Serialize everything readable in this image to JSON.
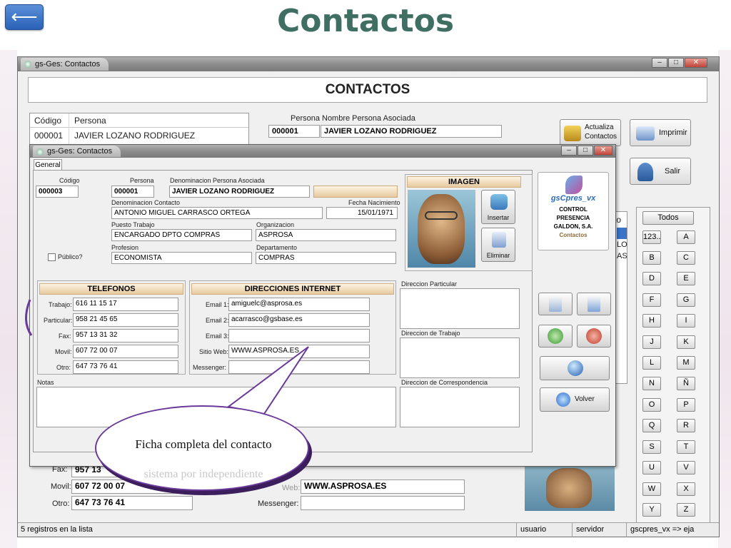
{
  "slide": {
    "title": "Contactos",
    "back_icon": "arrow-left-icon",
    "back_glyph": "⟵"
  },
  "window": {
    "title": "gs-Ges: Contactos",
    "header": "CONTACTOS",
    "list": {
      "headers": [
        "Código",
        "Persona"
      ],
      "rows": [
        {
          "codigo": "000001",
          "persona": "JAVIER LOZANO RODRIGUEZ"
        }
      ]
    },
    "persona_label": "Persona",
    "nombre_label": "Nombre Persona Asociada",
    "persona_code": "000001",
    "persona_name": "JAVIER LOZANO RODRIGUEZ",
    "btn_actualiza": "Actualiza Contactos",
    "btn_imprimir": "Imprimir",
    "btn_salir": "Salir",
    "partial_right": [
      "to",
      "LO",
      "AS"
    ],
    "bg_fields": [
      {
        "label": "Fax:",
        "value": "957 13"
      },
      {
        "label": "Movil:",
        "value": "607 72 00 07"
      },
      {
        "label": "Otro:",
        "value": "647 73 76 41"
      }
    ],
    "bg_web_label": "Web:",
    "bg_web_value": "WWW.ASPROSA.ES",
    "bg_messenger_label": "Messenger:",
    "alphabet": [
      "Todos",
      "123..",
      "A",
      "B",
      "C",
      "D",
      "E",
      "F",
      "G",
      "H",
      "I",
      "J",
      "K",
      "L",
      "M",
      "N",
      "Ñ",
      "O",
      "P",
      "Q",
      "R",
      "S",
      "T",
      "U",
      "V",
      "W",
      "X",
      "Y",
      "Z"
    ],
    "status": {
      "records": "5 registros en la lista",
      "user": "usuario",
      "server": "servidor",
      "app": "gscpres_vx => eja"
    }
  },
  "dialog": {
    "title": "gs-Ges: Contactos",
    "tab": "General",
    "codigo_label": "Código",
    "codigo": "000003",
    "persona_label": "Persona",
    "persona": "000001",
    "den_persona_label": "Denominacion Persona Asociada",
    "den_persona": "JAVIER LOZANO RODRIGUEZ",
    "den_contacto_label": "Denominacion Contacto",
    "den_contacto": "ANTONIO MIGUEL CARRASCO ORTEGA",
    "fecha_label": "Fecha Nacimiento",
    "fecha": "15/01/1971",
    "puesto_label": "Puesto Trabajo",
    "puesto": "ENCARGADO DPTO COMPRAS",
    "org_label": "Organizacion",
    "org": "ASPROSA",
    "profesion_label": "Profesion",
    "profesion": "ECONOMISTA",
    "depto_label": "Departamento",
    "depto": "COMPRAS",
    "publico_label": "Público?",
    "imagen_label": "IMAGEN",
    "insertar_label": "Insertar",
    "eliminar_label": "Eliminar",
    "logo": {
      "name": "gsCpres_vx",
      "l1": "CONTROL",
      "l2": "PRESENCIA",
      "l3": "GALDON, S.A.",
      "l4": "Contactos"
    },
    "telefonos_label": "TELEFONOS",
    "telefonos": [
      {
        "label": "Trabajo:",
        "value": "616 11 15 17"
      },
      {
        "label": "Particular:",
        "value": "958 21 45 65"
      },
      {
        "label": "Fax:",
        "value": "957 13 31 32"
      },
      {
        "label": "Movil:",
        "value": "607 72 00 07"
      },
      {
        "label": "Otro:",
        "value": "647 73 76 41"
      }
    ],
    "internet_label": "DIRECCIONES INTERNET",
    "internet": [
      {
        "label": "Email 1:",
        "value": "amiguelc@asprosa.es"
      },
      {
        "label": "Email 2:",
        "value": "acarrasco@gsbase.es"
      },
      {
        "label": "Email 3:",
        "value": ""
      },
      {
        "label": "Sitio Web:",
        "value": "WWW.ASPROSA.ES"
      },
      {
        "label": "Messenger:",
        "value": ""
      }
    ],
    "dir_particular_label": "Direccion Particular",
    "dir_trabajo_label": "Direccion de Trabajo",
    "dir_corresp_label": "Direccion de Correspondencia",
    "notas_label": "Notas",
    "volver_label": "Volver"
  },
  "callout": {
    "text": "Ficha completa del contacto",
    "ghost": "sistema por independiente"
  }
}
